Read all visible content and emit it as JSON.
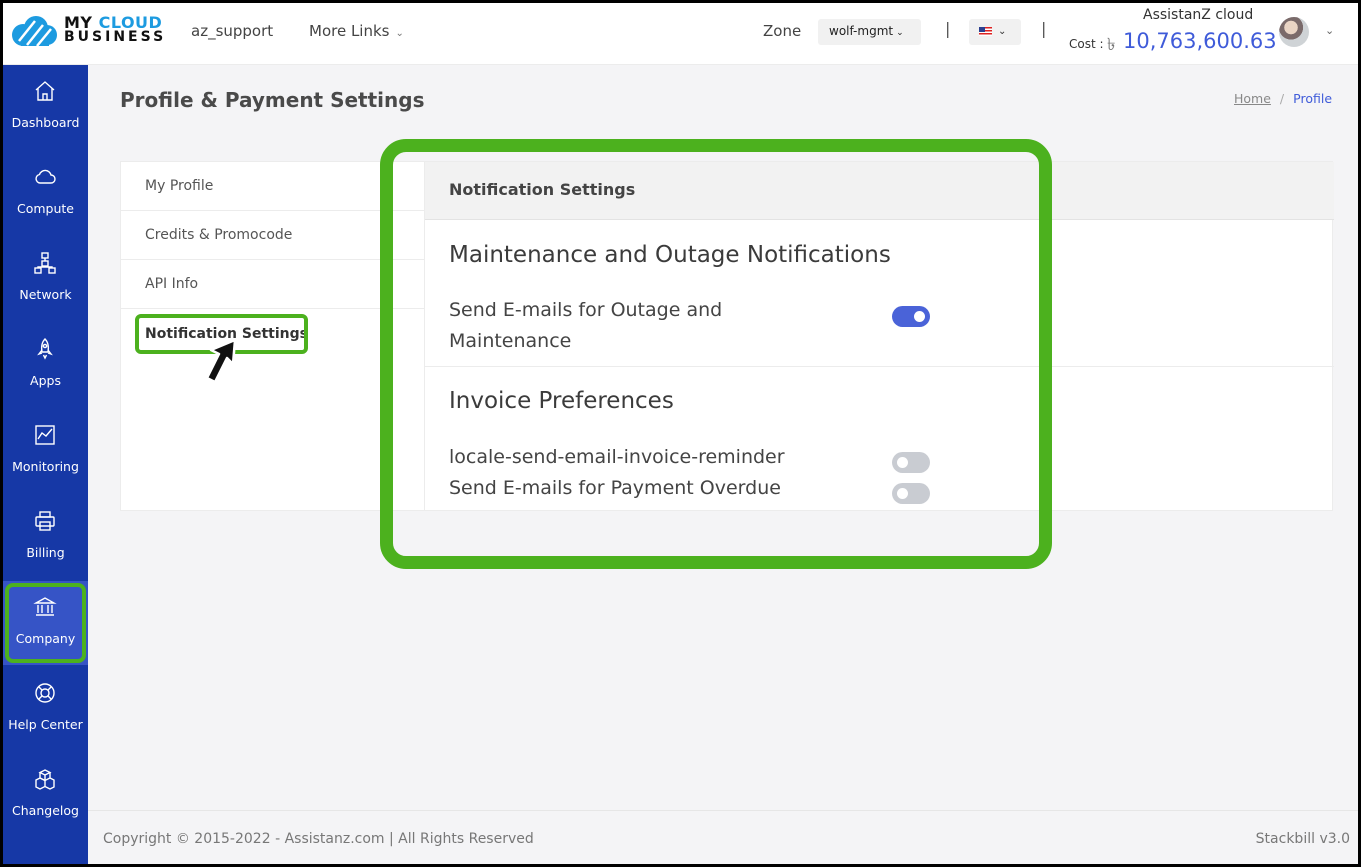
{
  "header": {
    "logo_line1_a": "MY ",
    "logo_line1_b": "CLOUD",
    "logo_line2": "BUSINESS",
    "user": "az_support",
    "more_links": "More Links",
    "zone_label": "Zone",
    "zone_value": "wolf-mgmt",
    "separator": "|",
    "account_name": "AssistanZ cloud",
    "cost_label": "Cost :",
    "cost_symbol": "৳",
    "cost_value": "10,763,600.63"
  },
  "sidebar": {
    "items": [
      {
        "label": "Dashboard",
        "icon": "home-icon"
      },
      {
        "label": "Compute",
        "icon": "cloud-icon"
      },
      {
        "label": "Network",
        "icon": "network-icon"
      },
      {
        "label": "Apps",
        "icon": "rocket-icon"
      },
      {
        "label": "Monitoring",
        "icon": "chart-icon"
      },
      {
        "label": "Billing",
        "icon": "printer-icon"
      },
      {
        "label": "Company",
        "icon": "bank-icon",
        "active": true
      },
      {
        "label": "Help Center",
        "icon": "lifebuoy-icon"
      },
      {
        "label": "Changelog",
        "icon": "cubes-icon"
      }
    ]
  },
  "page": {
    "title": "Profile & Payment Settings",
    "breadcrumb_home": "Home",
    "breadcrumb_sep": "/",
    "breadcrumb_current": "Profile"
  },
  "profile_menu": [
    {
      "label": "My Profile"
    },
    {
      "label": "Credits & Promocode"
    },
    {
      "label": "API Info"
    },
    {
      "label": "Notification Settings",
      "active": true
    }
  ],
  "panel": {
    "header": "Notification Settings",
    "maintenance_title": "Maintenance and Outage Notifications",
    "maintenance_option": "Send E-mails for Outage and Maintenance",
    "maintenance_enabled": true,
    "invoice_title": "Invoice Preferences",
    "invoice_options": [
      {
        "label": "locale-send-email-invoice-reminder",
        "enabled": false
      },
      {
        "label": "Send E-mails for Payment Overdue",
        "enabled": false
      }
    ]
  },
  "footer": {
    "copyright": "Copyright © 2015-2022 - Assistanz.com | All Rights Reserved",
    "version": "Stackbill v3.0"
  },
  "colors": {
    "sidebar": "#1638a6",
    "accent": "#3f5bd9",
    "highlight": "#4cb11e"
  }
}
